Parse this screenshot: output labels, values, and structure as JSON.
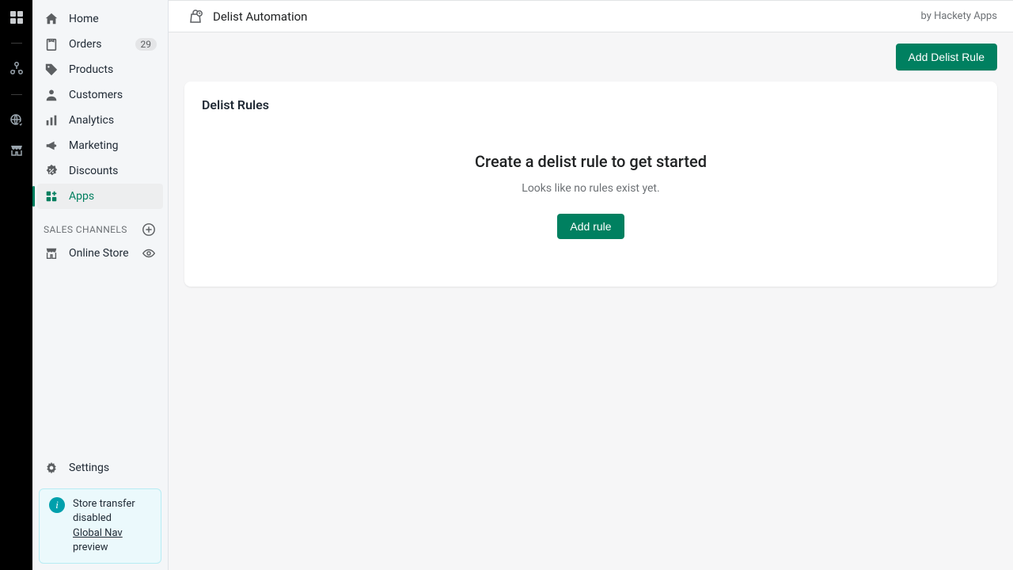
{
  "rail": {},
  "sidebar": {
    "items": [
      {
        "label": "Home"
      },
      {
        "label": "Orders",
        "badge": "29"
      },
      {
        "label": "Products"
      },
      {
        "label": "Customers"
      },
      {
        "label": "Analytics"
      },
      {
        "label": "Marketing"
      },
      {
        "label": "Discounts"
      },
      {
        "label": "Apps"
      }
    ],
    "section_header": "SALES CHANNELS",
    "channel": {
      "label": "Online Store"
    },
    "settings_label": "Settings",
    "banner": {
      "line1": "Store transfer disabled",
      "link": "Global Nav",
      "suffix": " preview"
    }
  },
  "topbar": {
    "title": "Delist Automation",
    "byline": "by Hackety Apps"
  },
  "actions": {
    "add_rule_top": "Add Delist Rule"
  },
  "card": {
    "title": "Delist Rules",
    "empty_heading": "Create a delist rule to get started",
    "empty_sub": "Looks like no rules exist yet.",
    "add_rule_btn": "Add rule"
  }
}
